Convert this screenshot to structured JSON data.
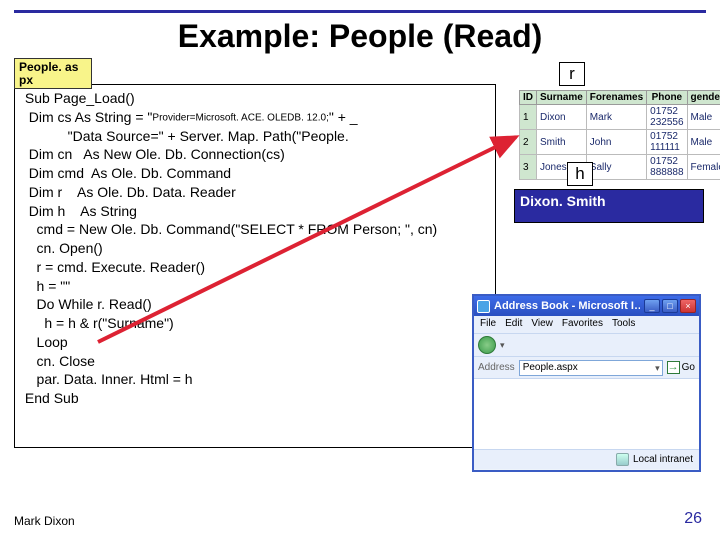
{
  "title": "Example: People (Read)",
  "filename": "People. as px",
  "code": {
    "line1": " Sub Page_Load()",
    "line2a": "  Dim cs As String = \"",
    "line2b": "Provider=Microsoft. ACE. OLEDB. 12.0;",
    "line2c": "\" + _",
    "line3": "            \"Data Source=\" + Server. Map. Path(\"People. ",
    "line4": "  Dim cn   As New Ole. Db. Connection(cs)",
    "line5": "  Dim cmd  As Ole. Db. Command",
    "line6": "  Dim r    As Ole. Db. Data. Reader",
    "line7": "  Dim h    As String",
    "line8": "    cmd = New Ole. Db. Command(\"SELECT * FROM Person; \", cn)",
    "line9": "    cn. Open()",
    "line10": "    r = cmd. Execute. Reader()",
    "line11": "    h = \"\"",
    "line12": "    Do While r. Read()",
    "line13": "      h = h & r(\"Surname\")",
    "line14": "    Loop",
    "line15": "    cn. Close",
    "line16": "    par. Data. Inner. Html = h",
    "line17": " End Sub"
  },
  "annotations": {
    "r_label": "r",
    "h_label": "h",
    "h_value": "Dixon. Smith"
  },
  "table": {
    "headers": [
      "ID",
      "Surname",
      "Forenames",
      "Phone",
      "gender"
    ],
    "rows": [
      [
        "1",
        "Dixon",
        "Mark",
        "01752 232556",
        "Male"
      ],
      [
        "2",
        "Smith",
        "John",
        "01752 111111",
        "Male"
      ],
      [
        "3",
        "Jones",
        "Sally",
        "01752 888888",
        "Female"
      ]
    ]
  },
  "browser": {
    "title": "Address Book - Microsoft I…",
    "menus": [
      "File",
      "Edit",
      "View",
      "Favorites",
      "Tools"
    ],
    "address_label": "Address",
    "address_value": "People.aspx",
    "go_label": "Go",
    "status_label": "Local intranet"
  },
  "footer": {
    "author": "Mark Dixon",
    "page": "26"
  }
}
